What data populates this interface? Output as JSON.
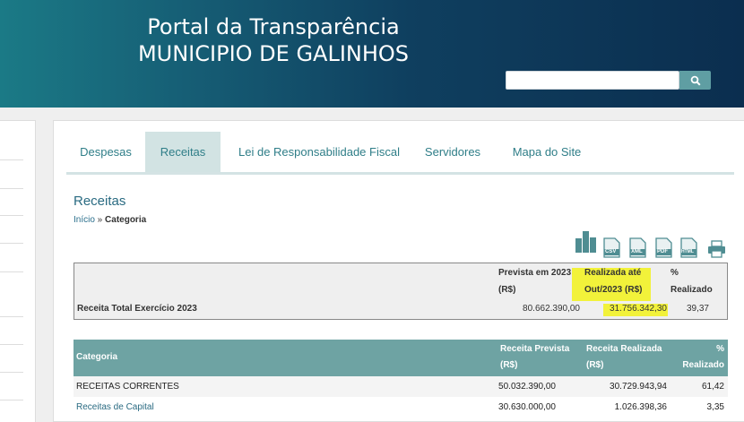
{
  "header": {
    "title_line1": "Portal da Transparência",
    "title_line2": "MUNICIPIO DE GALINHOS",
    "search_placeholder": "",
    "search_icon": "search-icon"
  },
  "nav": {
    "tabs": [
      {
        "label": "Despesas",
        "active": false
      },
      {
        "label": "Receitas",
        "active": true
      },
      {
        "label": "Lei de Responsabilidade Fiscal",
        "active": false
      },
      {
        "label": "Servidores",
        "active": false
      },
      {
        "label": "Mapa do Site",
        "active": false
      }
    ]
  },
  "page": {
    "title": "Receitas",
    "breadcrumb": {
      "home": "Início",
      "separator": " » ",
      "current": "Categoria"
    }
  },
  "exports": {
    "chart": "bar-chart-icon",
    "csv": "CSV",
    "xml": "XML",
    "pdf": "PDF",
    "html": "HTML",
    "print": "printer-icon"
  },
  "summary": {
    "col_prevista_l1": "Prevista em 2023",
    "col_prevista_l2": "(R$)",
    "col_realizada_l1": "Realizada até",
    "col_realizada_l2": "Out/2023 (R$)",
    "col_pct_l1": "%",
    "col_pct_l2": "Realizado",
    "row_label": "Receita Total Exercício 2023",
    "prevista": "80.662.390,00",
    "realizada": "31.756.342,30",
    "pct": "39,37",
    "highlight_color": "#f2f23a"
  },
  "categories": {
    "header": {
      "categoria": "Categoria",
      "prevista_l1": "Receita Prevista",
      "prevista_l2": "(R$)",
      "realizada_l1": "Receita Realizada",
      "realizada_l2": "(R$)",
      "pct_l1": "%",
      "pct_l2": "Realizado"
    },
    "rows": [
      {
        "name": "RECEITAS CORRENTES",
        "prevista": "50.032.390,00",
        "realizada": "30.729.943,94",
        "pct": "61,42"
      },
      {
        "name": "Receitas de Capital",
        "prevista": "30.630.000,00",
        "realizada": "1.026.398,36",
        "pct": "3,35"
      }
    ]
  },
  "colors": {
    "accent": "#2f7e88",
    "header_dark": "#0b2e4f",
    "table_header": "#6ea3a3"
  }
}
